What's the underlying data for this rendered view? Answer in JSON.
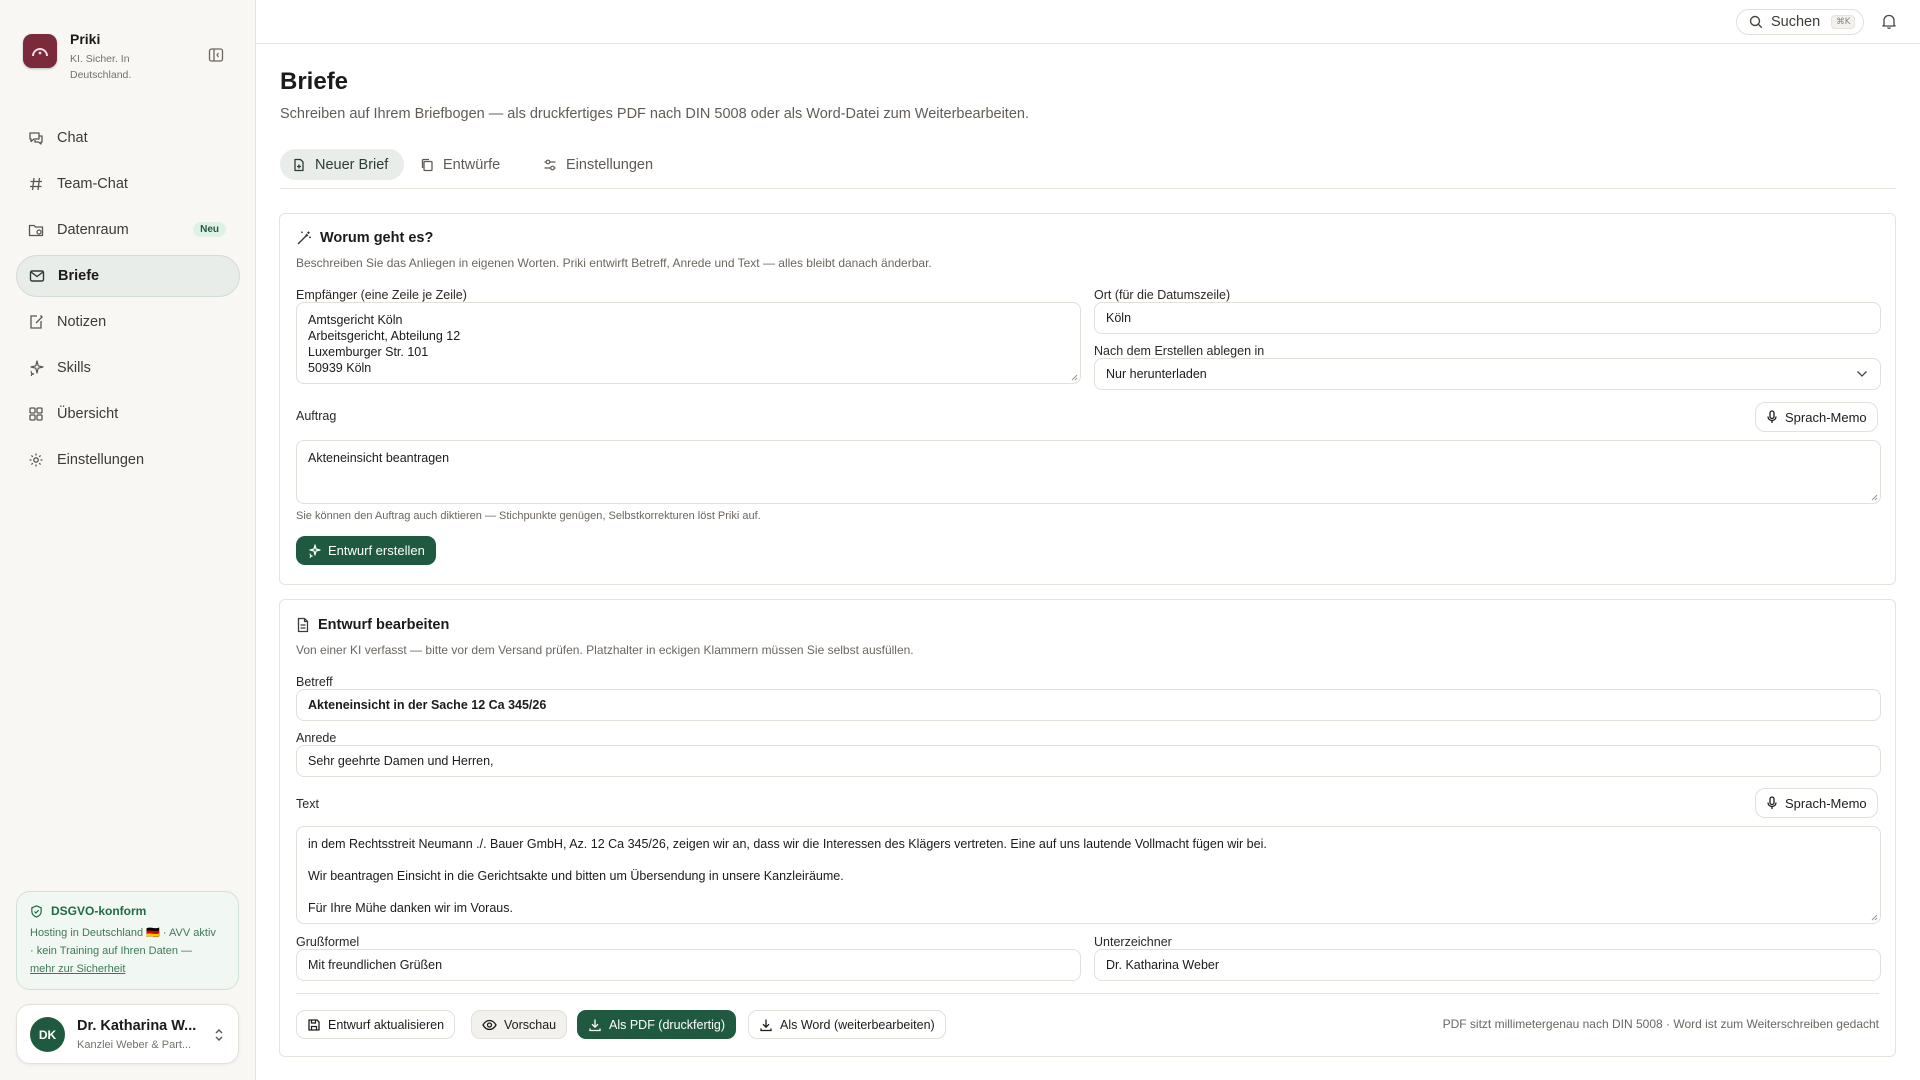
{
  "app": {
    "name": "Priki",
    "tagline": "KI. Sicher. In Deutschland."
  },
  "nav": {
    "items": [
      {
        "label": "Chat",
        "icon": "chat-icon"
      },
      {
        "label": "Team-Chat",
        "icon": "hash-icon"
      },
      {
        "label": "Datenraum",
        "icon": "folder-icon",
        "badge": "Neu"
      },
      {
        "label": "Briefe",
        "icon": "mail-icon",
        "active": true
      },
      {
        "label": "Notizen",
        "icon": "note-icon"
      },
      {
        "label": "Skills",
        "icon": "sparkle-icon"
      },
      {
        "label": "Übersicht",
        "icon": "grid-icon"
      },
      {
        "label": "Einstellungen",
        "icon": "gear-icon"
      }
    ]
  },
  "dsgvo": {
    "title": "DSGVO-konform",
    "line1": "Hosting in Deutschland 🇩🇪 · AVV aktiv",
    "line2": "· kein Training auf Ihren Daten —",
    "link": "mehr zur Sicherheit"
  },
  "user": {
    "initials": "DK",
    "name": "Dr. Katharina W...",
    "org": "Kanzlei Weber & Part..."
  },
  "topbar": {
    "search_label": "Suchen",
    "search_shortcut": "⌘K"
  },
  "page": {
    "title": "Briefe",
    "subtitle": "Schreiben auf Ihrem Briefbogen — als druckfertiges PDF nach DIN 5008 oder als Word-Datei zum Weiterbearbeiten."
  },
  "tabs": [
    {
      "label": "Neuer Brief",
      "active": true
    },
    {
      "label": "Entwürfe"
    },
    {
      "label": "Einstellungen"
    }
  ],
  "request": {
    "title": "Worum geht es?",
    "description": "Beschreiben Sie das Anliegen in eigenen Worten. Priki entwirft Betreff, Anrede und Text — alles bleibt danach änderbar.",
    "recipient_label": "Empfänger (eine Zeile je Zeile)",
    "recipient_lines": [
      "Amtsgericht Köln",
      "Arbeitsgericht, Abteilung 12",
      "Luxemburger Str. 101",
      "50939 Köln"
    ],
    "place_label": "Ort (für die Datumszeile)",
    "place_value": "Köln",
    "store_label": "Nach dem Erstellen ablegen in",
    "store_value": "Nur herunterladen",
    "task_label": "Auftrag",
    "voice_memo": "Sprach-Memo",
    "task_value": "Akteneinsicht beantragen",
    "hint": "Sie können den Auftrag auch diktieren — Stichpunkte genügen, Selbstkorrekturen löst Priki auf.",
    "create_button": "Entwurf erstellen"
  },
  "draft": {
    "title": "Entwurf bearbeiten",
    "description": "Von einer KI verfasst — bitte vor dem Versand prüfen. Platzhalter in eckigen Klammern müssen Sie selbst ausfüllen.",
    "subject_label": "Betreff",
    "subject_value": "Akteneinsicht in der Sache 12 Ca 345/26",
    "salutation_label": "Anrede",
    "salutation_value": "Sehr geehrte Damen und Herren,",
    "text_label": "Text",
    "voice_memo": "Sprach-Memo",
    "text_paragraphs": [
      "in dem Rechtsstreit Neumann ./. Bauer GmbH, Az. 12 Ca 345/26, zeigen wir an, dass wir die Interessen des Klägers vertreten. Eine auf uns lautende Vollmacht fügen wir bei.",
      "Wir beantragen Einsicht in die Gerichtsakte und bitten um Übersendung in unsere Kanzleiräume.",
      "Für Ihre Mühe danken wir im Voraus."
    ],
    "closing_label": "Grußformel",
    "closing_value": "Mit freundlichen Grüßen",
    "signer_label": "Unterzeichner",
    "signer_value": "Dr. Katharina Weber",
    "actions": {
      "update": "Entwurf aktualisieren",
      "preview": "Vorschau",
      "pdf": "Als PDF (druckfertig)",
      "word": "Als Word (weiterbearbeiten)"
    },
    "footer_note": "PDF sitzt millimetergenau nach DIN 5008 · Word ist zum Weiterschreiben gedacht"
  },
  "colors": {
    "brand": "#7a2a3b",
    "accent": "#1f5a40",
    "active_bg": "#e9ede9",
    "dsgvo_bg": "#f1f7f2"
  }
}
